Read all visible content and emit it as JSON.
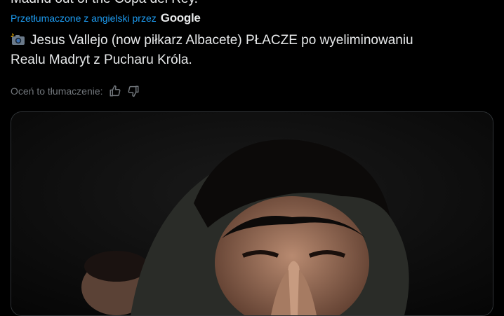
{
  "tweet": {
    "original_text_tail": "Madrid out of the Copa del Rey.",
    "translated_by": "Przetłumaczone z angielski przez",
    "translator": "Google",
    "emoji_icon": "camera-flash-icon",
    "text_line1": "Jesus Vallejo (now piłkarz Albacete) PŁACZE po wyeliminowaniu",
    "text_line2": "Realu Madryt z Pucharu Króla.",
    "rate_label": "Oceń to tłumaczenie:",
    "rate_icons": [
      "thumbs-up-icon",
      "thumbs-down-icon"
    ],
    "media_alt": "Zdjęcie"
  },
  "colors": {
    "background": "#000000",
    "text": "#e7e9ea",
    "link": "#1d9bf0",
    "muted": "#71767b",
    "border": "#2f3336"
  }
}
